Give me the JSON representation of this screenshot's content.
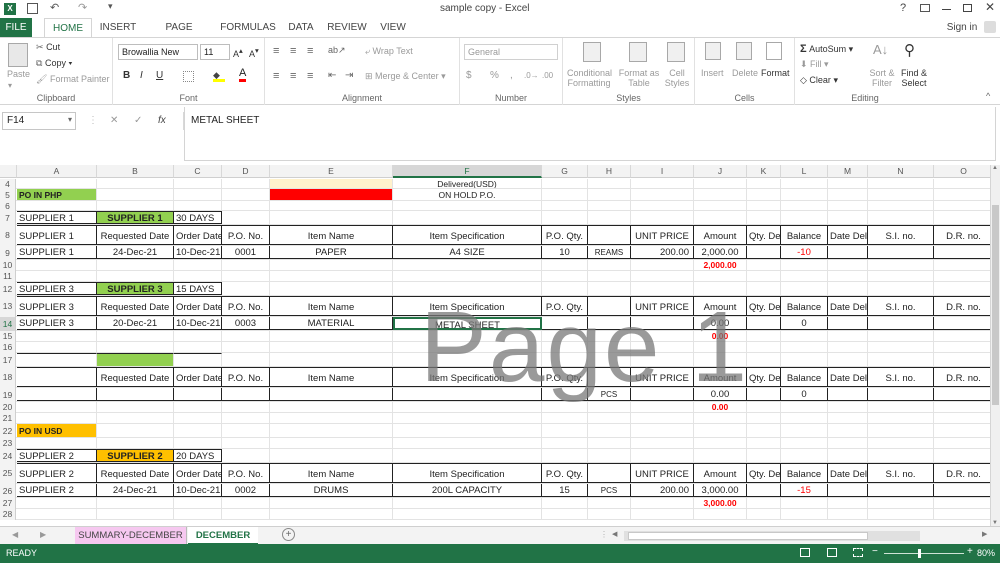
{
  "window": {
    "title": "sample copy - Excel",
    "help": "?",
    "sign_in": "Sign in"
  },
  "ribbon_tabs": [
    "FILE",
    "HOME",
    "INSERT",
    "PAGE LAYOUT",
    "FORMULAS",
    "DATA",
    "REVIEW",
    "VIEW"
  ],
  "ribbon": {
    "clipboard": {
      "label": "Clipboard",
      "paste": "Paste",
      "cut": "Cut",
      "copy": "Copy",
      "format_painter": "Format Painter"
    },
    "font": {
      "label": "Font",
      "name": "Browallia New",
      "size": "11",
      "bold": "B",
      "italic": "I",
      "underline": "U"
    },
    "alignment": {
      "label": "Alignment",
      "wrap": "Wrap Text",
      "merge": "Merge & Center"
    },
    "number": {
      "label": "Number",
      "format": "General",
      "currency": "$",
      "percent": "%",
      "comma": ","
    },
    "styles": {
      "label": "Styles",
      "conditional": "Conditional Formatting",
      "format_table": "Format as Table",
      "cell_styles": "Cell Styles"
    },
    "cells": {
      "label": "Cells",
      "insert": "Insert",
      "delete": "Delete",
      "format": "Format"
    },
    "editing": {
      "label": "Editing",
      "autosum": "AutoSum",
      "fill": "Fill",
      "clear": "Clear",
      "sort": "Sort & Filter",
      "find": "Find & Select"
    }
  },
  "formula_bar": {
    "name_box": "F14",
    "fx": "fx",
    "content": "METAL SHEET"
  },
  "columns": [
    "A",
    "B",
    "C",
    "D",
    "E",
    "F",
    "G",
    "H",
    "I",
    "J",
    "K",
    "L",
    "M",
    "N",
    "O"
  ],
  "rows": [
    {
      "n": "4",
      "cells": {
        "F": "Delivered(USD)"
      }
    },
    {
      "n": "5",
      "cells": {
        "A": "PO IN PHP",
        "F": "ON HOLD P.O."
      }
    },
    {
      "n": "6",
      "cells": {}
    },
    {
      "n": "7",
      "cells": {
        "A": "SUPPLIER 1",
        "B": "SUPPLIER 1",
        "C": "30 DAYS"
      }
    },
    {
      "n": "8",
      "cells": {
        "A": "SUPPLIER 1",
        "B": "Requested Date",
        "C": "Order Date",
        "D": "P.O. No.",
        "E": "Item Name",
        "F": "Item Specification",
        "G": "P.O. Qty.",
        "I": "UNIT PRICE",
        "J": "Amount",
        "K": "Qty. Del.",
        "L": "Balance",
        "M": "Date Del.",
        "N": "S.I. no.",
        "O": "D.R. no."
      }
    },
    {
      "n": "9",
      "cells": {
        "A": "SUPPLIER 1",
        "B": "24-Dec-21",
        "C": "10-Dec-21",
        "D": "0001",
        "E": "PAPER",
        "F": "A4 SIZE",
        "G": "10",
        "H": "REAMS",
        "I": "200.00",
        "J": "2,000.00",
        "L": "-10"
      }
    },
    {
      "n": "10",
      "cells": {
        "J": "2,000.00"
      }
    },
    {
      "n": "11",
      "cells": {}
    },
    {
      "n": "12",
      "cells": {
        "A": "SUPPLIER 3",
        "B": "SUPPLIER 3",
        "C": "15 DAYS"
      }
    },
    {
      "n": "13",
      "cells": {
        "A": "SUPPLIER 3",
        "B": "Requested Date",
        "C": "Order Date",
        "D": "P.O. No.",
        "E": "Item Name",
        "F": "Item Specification",
        "G": "P.O. Qty.",
        "I": "UNIT PRICE",
        "J": "Amount",
        "K": "Qty. Del.",
        "L": "Balance",
        "M": "Date Del.",
        "N": "S.I. no.",
        "O": "D.R. no."
      }
    },
    {
      "n": "14",
      "cells": {
        "A": "SUPPLIER 3",
        "B": "20-Dec-21",
        "C": "10-Dec-21",
        "D": "0003",
        "E": "MATERIAL",
        "F": "METAL SHEET",
        "J": "0.00",
        "L": "0"
      }
    },
    {
      "n": "15",
      "cells": {
        "J": "0.00"
      }
    },
    {
      "n": "16",
      "cells": {}
    },
    {
      "n": "17",
      "cells": {}
    },
    {
      "n": "18",
      "cells": {
        "B": "Requested Date",
        "C": "Order Date",
        "D": "P.O. No.",
        "E": "Item Name",
        "F": "Item Specification",
        "G": "P.O. Qty.",
        "I": "UNIT PRICE",
        "J": "Amount",
        "K": "Qty. Del.",
        "L": "Balance",
        "M": "Date Del.",
        "N": "S.I. no.",
        "O": "D.R. no."
      }
    },
    {
      "n": "19",
      "cells": {
        "H": "PCS",
        "J": "0.00",
        "L": "0"
      }
    },
    {
      "n": "20",
      "cells": {
        "J": "0.00"
      }
    },
    {
      "n": "21",
      "cells": {}
    },
    {
      "n": "22",
      "cells": {
        "A": "PO IN USD"
      }
    },
    {
      "n": "23",
      "cells": {}
    },
    {
      "n": "24",
      "cells": {
        "A": "SUPPLIER 2",
        "B": "SUPPLIER 2",
        "C": "20 DAYS"
      }
    },
    {
      "n": "25",
      "cells": {
        "A": "SUPPLIER 2",
        "B": "Requested Date",
        "C": "Order Date",
        "D": "P.O. No.",
        "E": "Item Name",
        "F": "Item Specification",
        "G": "P.O. Qty.",
        "I": "UNIT PRICE",
        "J": "Amount",
        "K": "Qty. Del.",
        "L": "Balance",
        "M": "Date Del.",
        "N": "S.I. no.",
        "O": "D.R. no."
      }
    },
    {
      "n": "26",
      "cells": {
        "A": "SUPPLIER 2",
        "B": "24-Dec-21",
        "C": "10-Dec-21",
        "D": "0002",
        "E": "DRUMS",
        "F": "200L CAPACITY",
        "G": "15",
        "H": "PCS",
        "I": "200.00",
        "J": "3,000.00",
        "L": "-15"
      }
    },
    {
      "n": "27",
      "cells": {
        "J": "3,000.00"
      }
    },
    {
      "n": "28",
      "cells": {}
    }
  ],
  "watermark": "Page 1",
  "sheet_tabs": [
    "SUMMARY-DECEMBER",
    "DECEMBER"
  ],
  "active_sheet": "DECEMBER",
  "status": {
    "ready": "READY",
    "zoom": "80%"
  },
  "colors": {
    "excel_green": "#217346",
    "header_green": "#92d050",
    "orange": "#ffc000",
    "red_fill": "#ff0000",
    "red_text": "#ff0000",
    "pink_tab": "#f6c8f0",
    "light_yellow": "#fff2cc"
  }
}
